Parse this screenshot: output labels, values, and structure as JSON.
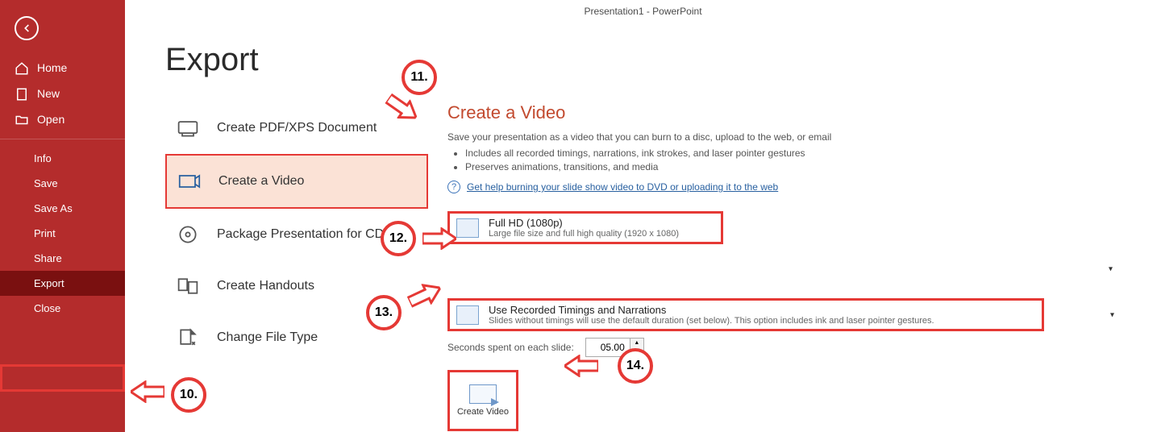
{
  "titlebar": "Presentation1 - PowerPoint",
  "sidebar": {
    "home": "Home",
    "new": "New",
    "open": "Open",
    "info": "Info",
    "save": "Save",
    "saveas": "Save As",
    "print": "Print",
    "share": "Share",
    "export": "Export",
    "close": "Close"
  },
  "page_title": "Export",
  "export_options": {
    "pdf": "Create PDF/XPS Document",
    "video": "Create a Video",
    "cd": "Package Presentation for CD",
    "handouts": "Create Handouts",
    "changetype": "Change File Type"
  },
  "right": {
    "title": "Create a Video",
    "desc": "Save your presentation as a video that you can burn to a disc, upload to the web, or email",
    "bullet1": "Includes all recorded timings, narrations, ink strokes, and laser pointer gestures",
    "bullet2": "Preserves animations, transitions, and media",
    "help_link": "Get help burning your slide show video to DVD or uploading it to the web",
    "quality": {
      "title": "Full HD (1080p)",
      "sub": "Large file size and full high quality (1920 x 1080)"
    },
    "timings": {
      "title": "Use Recorded Timings and Narrations",
      "sub": "Slides without timings will use the default duration (set below). This option includes ink and laser pointer gestures."
    },
    "seconds_label": "Seconds spent on each slide:",
    "seconds_value": "05.00",
    "create_label": "Create Video"
  },
  "annotations": {
    "b10": "10.",
    "b11": "11.",
    "b12": "12.",
    "b13": "13.",
    "b14": "14."
  }
}
